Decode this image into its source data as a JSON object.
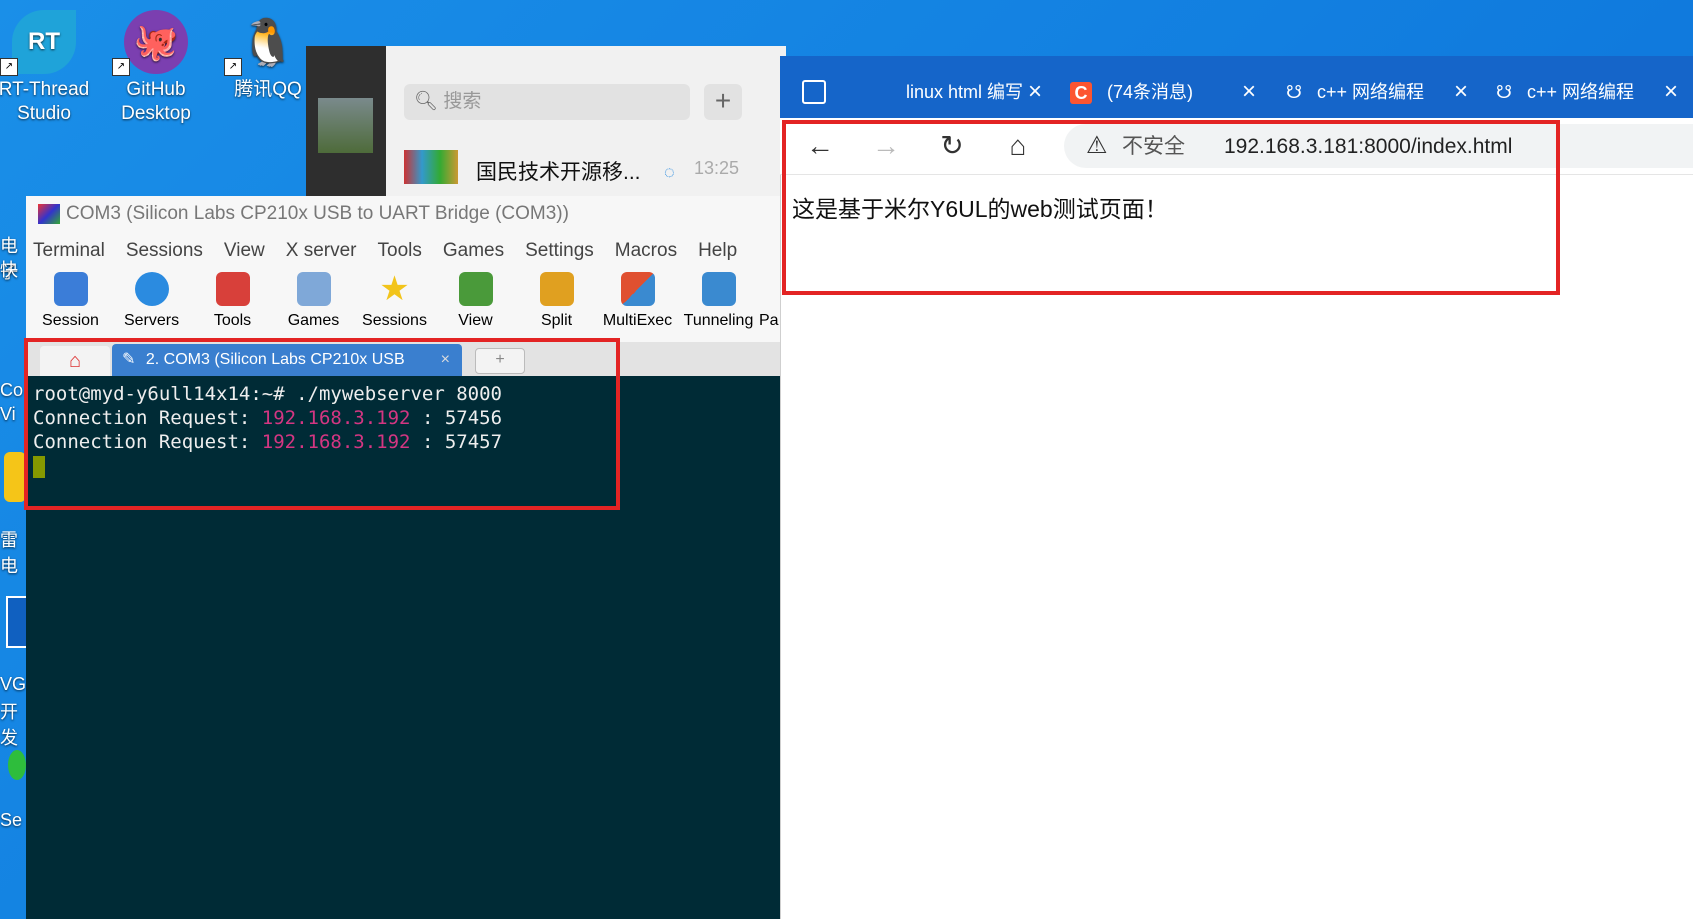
{
  "desktop": {
    "icons": [
      {
        "label_l1": "RT-Thread",
        "label_l2": "Studio",
        "color": "#1fa3d9"
      },
      {
        "label_l1": "GitHub",
        "label_l2": "Desktop",
        "color": "#7b3fb0"
      },
      {
        "label_l1": "腾讯QQ",
        "label_l2": "",
        "color": "#ffffff"
      }
    ],
    "left_labels": [
      "电子",
      "快",
      "Co",
      "Vi",
      "雷电",
      "VG",
      "开发",
      "Se"
    ]
  },
  "chat": {
    "search_placeholder": "搜索",
    "add_symbol": "+",
    "item_title": "国民技术开源移...",
    "item_time": "13:25"
  },
  "moba": {
    "title": "COM3  (Silicon Labs CP210x USB to UART Bridge (COM3))",
    "menu": [
      "Terminal",
      "Sessions",
      "View",
      "X server",
      "Tools",
      "Games",
      "Settings",
      "Macros",
      "Help"
    ],
    "toolbar": [
      {
        "label": "Session",
        "icon": "session-icon",
        "color": "#3b7dd8"
      },
      {
        "label": "Servers",
        "icon": "servers-icon",
        "color": "#2b8be0"
      },
      {
        "label": "Tools",
        "icon": "tools-icon",
        "color": "#d8403a"
      },
      {
        "label": "Games",
        "icon": "games-icon",
        "color": "#7fa8d8"
      },
      {
        "label": "Sessions",
        "icon": "sessions-star-icon",
        "color": "#f2c41a"
      },
      {
        "label": "View",
        "icon": "view-icon",
        "color": "#4a9a3a"
      },
      {
        "label": "Split",
        "icon": "split-icon",
        "color": "#e0a020"
      },
      {
        "label": "MultiExec",
        "icon": "multiexec-icon",
        "color": "#e05030"
      },
      {
        "label": "Tunneling",
        "icon": "tunneling-icon",
        "color": "#3a8ad0"
      },
      {
        "label": "Pa",
        "icon": "packages-icon",
        "color": "#777777"
      }
    ],
    "tab_label": "2. COM3  (Silicon Labs CP210x USB",
    "tab_close": "×",
    "tab_new": "+",
    "terminal": {
      "prompt": "root@myd-y6ull14x14:~# ./mywebserver 8000",
      "lines": [
        {
          "prefix": "Connection Request: ",
          "ip": "192.168.3.192",
          "suffix": " : 57456"
        },
        {
          "prefix": "Connection Request: ",
          "ip": "192.168.3.192",
          "suffix": " : 57457"
        }
      ]
    }
  },
  "browser": {
    "tabs": [
      {
        "title": "linux html 编写",
        "close": "×"
      },
      {
        "title": "(74条消息)",
        "close": "×"
      },
      {
        "title": "c++ 网络编程",
        "close": "×"
      },
      {
        "title": "c++ 网络编程",
        "close": "×"
      }
    ],
    "security_label": "不安全",
    "url": "192.168.3.181:8000/index.html",
    "page_text": "这是基于米尔Y6UL的web测试页面！"
  }
}
